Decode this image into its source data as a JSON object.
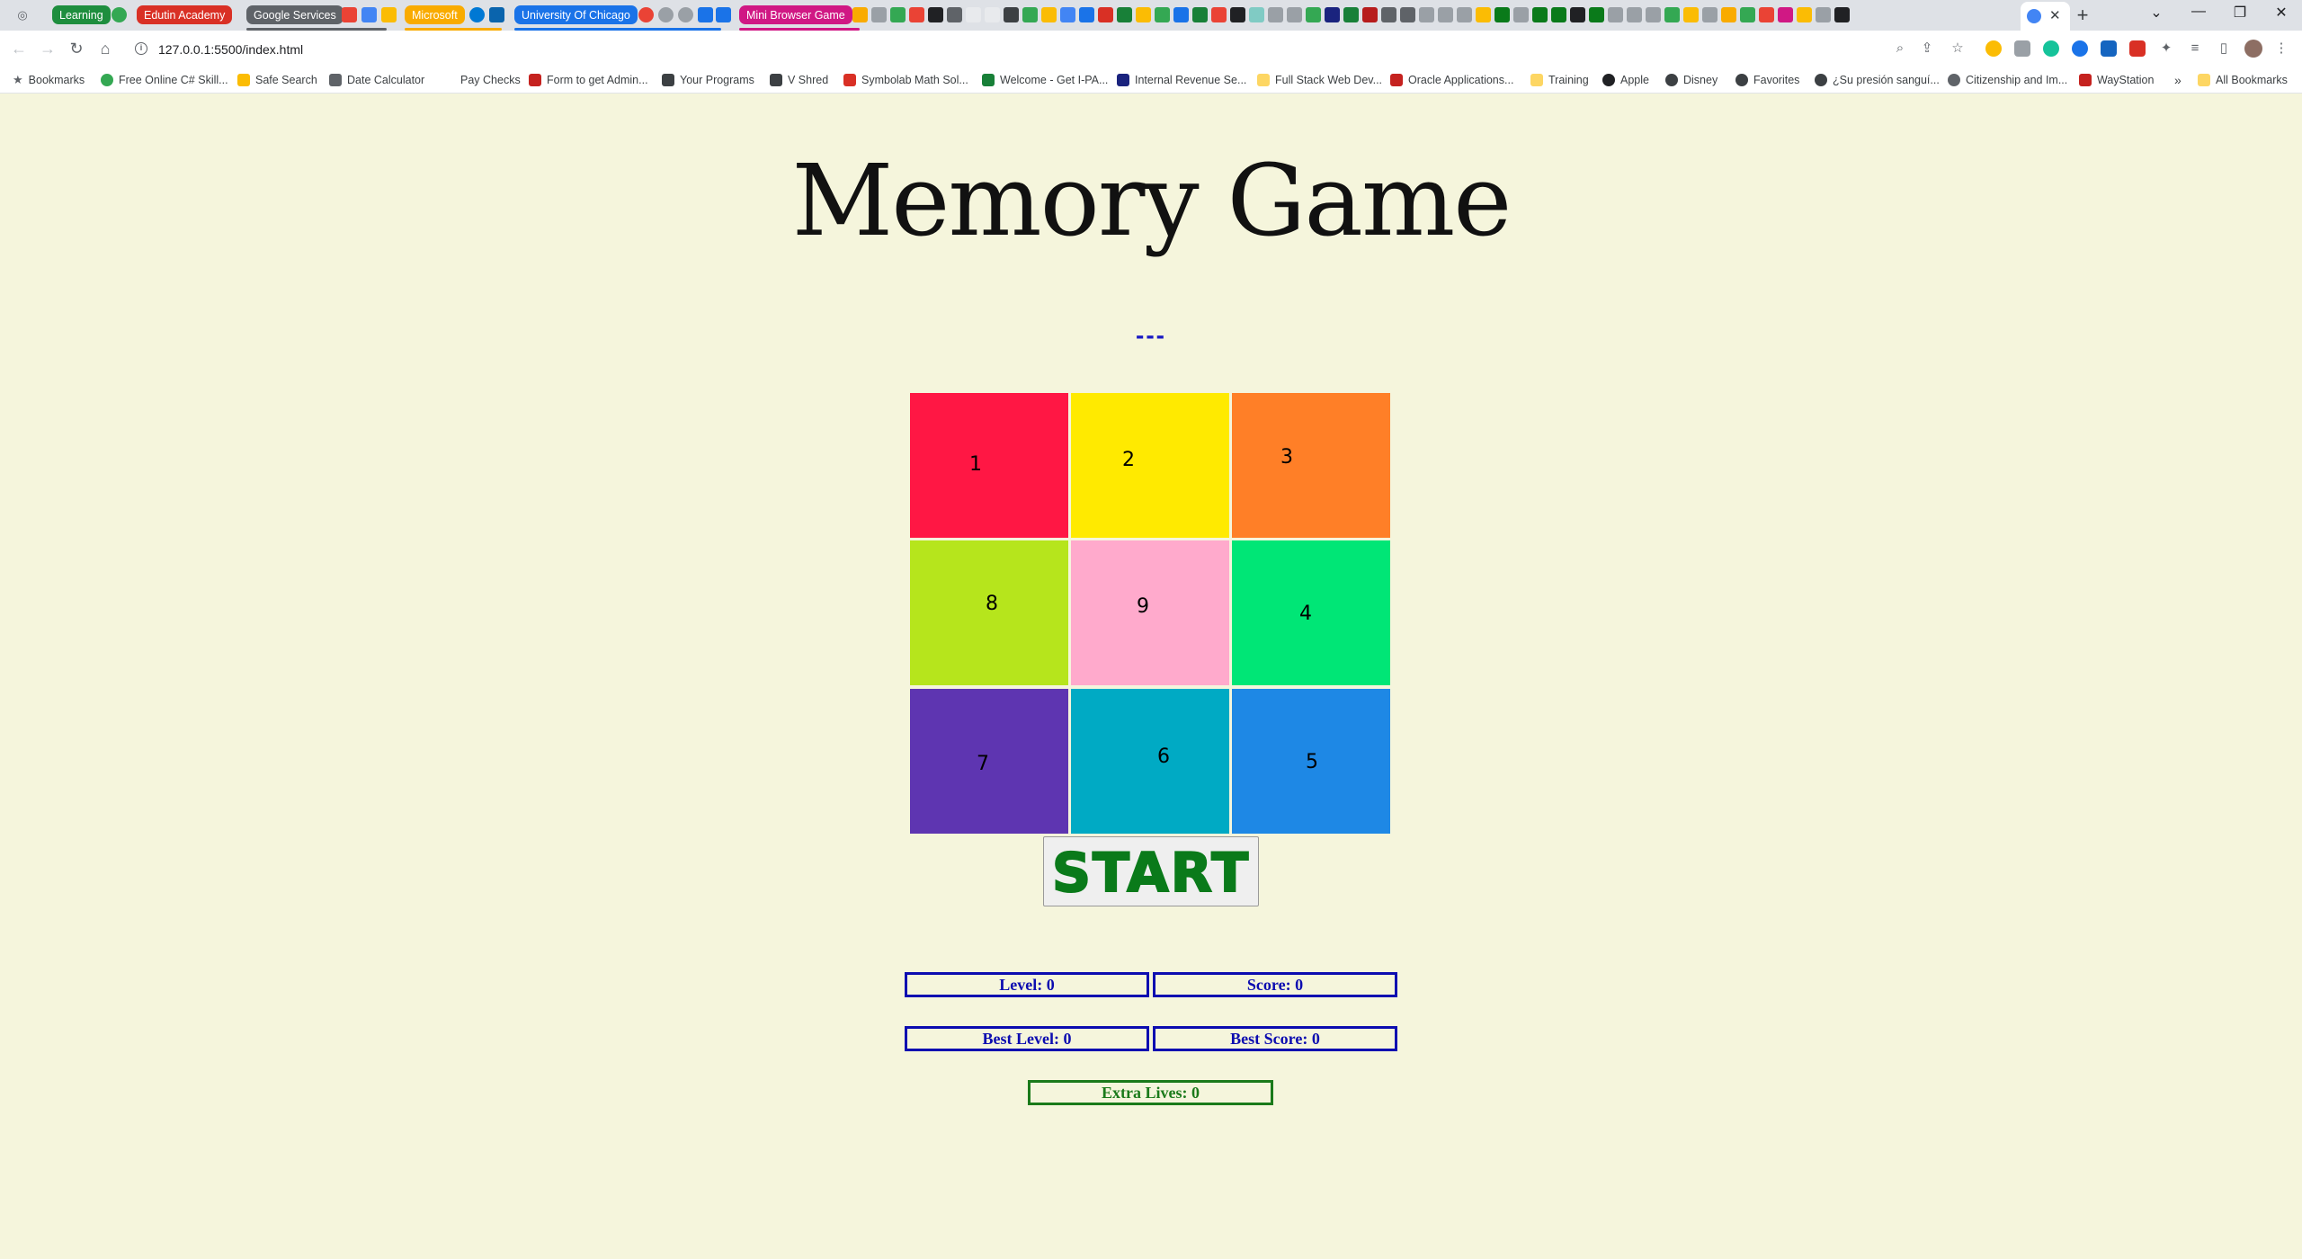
{
  "browser": {
    "tab_groups": [
      {
        "label": "Learning",
        "color": "#1e8e3e"
      },
      {
        "label": "Edutin Academy",
        "color": "#d93025"
      },
      {
        "label": "Google Services",
        "color": "#5f6368"
      },
      {
        "label": "Microsoft",
        "color": "#f9ab00"
      },
      {
        "label": "University Of Chicago",
        "color": "#1a73e8"
      },
      {
        "label": "Mini Browser Game",
        "color": "#d01884"
      }
    ],
    "active_tab_close": "✕",
    "new_tab": "+",
    "window_controls": {
      "dropdown": "⌄",
      "minimize": "—",
      "restore": "❐",
      "close": "✕"
    },
    "url": "127.0.0.1:5500/index.html",
    "bookmarks": [
      {
        "label": "Bookmarks",
        "icon": "star-icon"
      },
      {
        "label": "Free Online C# Skill...",
        "icon": "globe-icon"
      },
      {
        "label": "Safe Search",
        "icon": "check-icon"
      },
      {
        "label": "Date Calculator",
        "icon": "calendar-icon"
      },
      {
        "label": "Pay Checks",
        "icon": "blank-icon"
      },
      {
        "label": "Form to get Admin...",
        "icon": "form-icon"
      },
      {
        "label": "Your Programs",
        "icon": "v-icon"
      },
      {
        "label": "V Shred",
        "icon": "v-icon"
      },
      {
        "label": "Symbolab Math Sol...",
        "icon": "symbolab-icon"
      },
      {
        "label": "Welcome - Get I-PA...",
        "icon": "pen-icon"
      },
      {
        "label": "Internal Revenue Se...",
        "icon": "irs-icon"
      },
      {
        "label": "Full Stack Web Dev...",
        "icon": "folder-icon"
      },
      {
        "label": "Oracle Applications...",
        "icon": "oracle-icon"
      },
      {
        "label": "Training",
        "icon": "folder-icon"
      },
      {
        "label": "Apple",
        "icon": "apple-icon"
      },
      {
        "label": "Disney",
        "icon": "disney-icon"
      },
      {
        "label": "Favorites",
        "icon": "globe-icon"
      },
      {
        "label": "¿Su presión sanguí...",
        "icon": "globe-icon"
      },
      {
        "label": "Citizenship and Im...",
        "icon": "uscis-icon"
      },
      {
        "label": "WayStation",
        "icon": "waystation-icon"
      }
    ],
    "bookmarks_overflow": "»",
    "all_bookmarks": "All Bookmarks"
  },
  "page": {
    "title": "Memory Game",
    "status": "---",
    "tiles": [
      {
        "number": "1",
        "color": "#ff1744"
      },
      {
        "number": "2",
        "color": "#ffea00"
      },
      {
        "number": "3",
        "color": "#ff7f27"
      },
      {
        "number": "8",
        "color": "#b6e51c"
      },
      {
        "number": "9",
        "color": "#ffaacc"
      },
      {
        "number": "4",
        "color": "#00e676"
      },
      {
        "number": "7",
        "color": "#5e35b1"
      },
      {
        "number": "6",
        "color": "#00aac4"
      },
      {
        "number": "5",
        "color": "#1e88e5"
      }
    ],
    "start_label": "START",
    "stats": {
      "level": "Level: 0",
      "score": "Score: 0",
      "best_level": "Best Level: 0",
      "best_score": "Best Score: 0",
      "extra_lives": "Extra Lives: 0"
    }
  }
}
